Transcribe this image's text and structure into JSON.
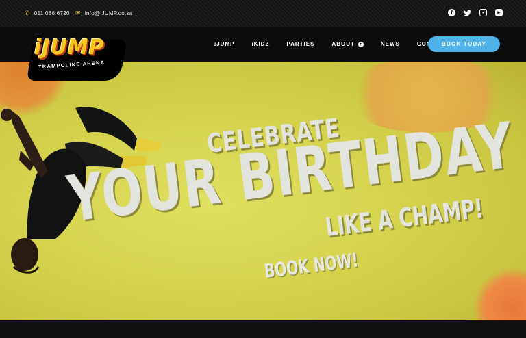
{
  "topbar": {
    "phone": "011 086 6720",
    "email": "info@iJUMP.co.za",
    "phone_icon": "phone-icon",
    "email_icon": "mail-icon",
    "social": [
      "facebook-icon",
      "twitter-icon",
      "instagram-icon",
      "youtube-icon"
    ]
  },
  "logo": {
    "word": "iJUMP",
    "sub": "TRAMPOLINE ARENA"
  },
  "nav": {
    "items": [
      "iJUMP",
      "iKIDZ",
      "PARTIES",
      "ABOUT",
      "NEWS",
      "CONTACT US"
    ],
    "cta": "BOOK TODAY"
  },
  "hero": {
    "line1": "CELEBRATE",
    "line2": "YOUR BIRTHDAY",
    "line3": "LIKE A CHAMP!",
    "line4": "BOOK NOW!"
  },
  "colors": {
    "accent": "#f2c230",
    "cta": "#4fb2e8",
    "hero_bg": "#d6d44f",
    "nav_bg": "#0c0c0c"
  }
}
